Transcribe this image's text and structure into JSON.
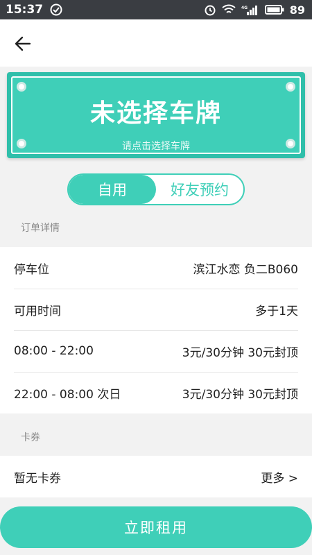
{
  "status_bar": {
    "time": "15:37",
    "battery": "89"
  },
  "plate": {
    "title": "未选择车牌",
    "hint": "请点击选择车牌"
  },
  "segment": {
    "tab_self": "自用",
    "tab_friend": "好友预约"
  },
  "order_section": {
    "label": "订单详情",
    "rows": [
      {
        "label": "停车位",
        "value": "滨江水恋 负二B060"
      },
      {
        "label": "可用时间",
        "value": "多于1天"
      },
      {
        "label": "08:00 - 22:00",
        "value": "3元/30分钟 30元封顶"
      },
      {
        "label": "22:00 - 08:00 次日",
        "value": "3元/30分钟 30元封顶"
      }
    ]
  },
  "coupon_section": {
    "label": "卡券",
    "row": {
      "label": "暂无卡券",
      "value": "更多 >"
    }
  },
  "action": {
    "rent_now": "立即租用"
  },
  "colors": {
    "accent": "#3fcfb8",
    "status_bar": "#3a3d42"
  }
}
